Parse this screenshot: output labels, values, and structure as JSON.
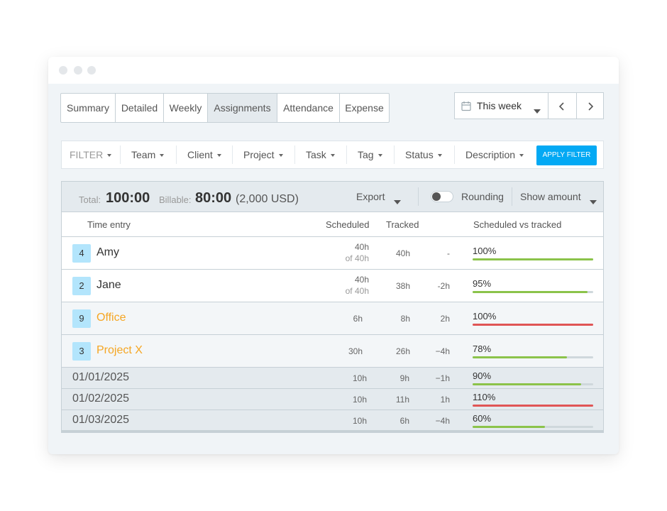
{
  "tabs": [
    {
      "label": "Summary"
    },
    {
      "label": "Detailed"
    },
    {
      "label": "Weekly"
    },
    {
      "label": "Assignments",
      "active": true
    },
    {
      "label": "Attendance"
    },
    {
      "label": "Expense"
    }
  ],
  "date_range": {
    "label": "This week"
  },
  "filter": {
    "title": "FILTER",
    "items": [
      "Team",
      "Client",
      "Project",
      "Task",
      "Tag",
      "Status",
      "Description"
    ],
    "apply_label": "APPLY FILTER"
  },
  "summary": {
    "total_label": "Total:",
    "total_value": "100:00",
    "billable_label": "Billable:",
    "billable_value": "80:00",
    "billable_amount": "(2,000 USD)",
    "export_label": "Export",
    "rounding_label": "Rounding",
    "show_amount_label": "Show amount"
  },
  "columns": {
    "time_entry": "Time entry",
    "scheduled": "Scheduled",
    "tracked": "Tracked",
    "scheduled_vs_tracked": "Scheduled vs tracked"
  },
  "entries": [
    {
      "count": "4",
      "name": "Amy",
      "scheduled": "40h",
      "scheduled_sub": "of 40h",
      "tracked": "40h",
      "diff": "-",
      "percent": "100%",
      "progress": 1.0,
      "over": false
    },
    {
      "count": "2",
      "name": "Jane",
      "scheduled": "40h",
      "scheduled_sub": "of 40h",
      "tracked": "38h",
      "diff": "-2h",
      "percent": "95%",
      "progress": 0.95,
      "over": false
    },
    {
      "count": "9",
      "name": "Office",
      "scheduled": "6h",
      "tracked": "8h",
      "diff": "2h",
      "percent": "100%",
      "progress": 1.0,
      "over": true
    },
    {
      "count": "3",
      "name": "Project X",
      "scheduled": "30h",
      "tracked": "26h",
      "diff": "−4h",
      "percent": "78%",
      "progress": 0.78,
      "over": false
    }
  ],
  "days": [
    {
      "date": "01/01/2025",
      "scheduled": "10h",
      "tracked": "9h",
      "diff": "−1h",
      "percent": "90%",
      "progress": 0.9,
      "over": false
    },
    {
      "date": "01/02/2025",
      "scheduled": "10h",
      "tracked": "11h",
      "diff": "1h",
      "percent": "110%",
      "progress": 1.0,
      "over": true
    },
    {
      "date": "01/03/2025",
      "scheduled": "10h",
      "tracked": "6h",
      "diff": "−4h",
      "percent": "60%",
      "progress": 0.6,
      "over": false
    }
  ],
  "colors": {
    "accent": "#03a9f4",
    "badge": "#b3e5fc",
    "project_name": "#f5a623",
    "bar_green": "#8bc34a",
    "bar_red": "#e05555"
  },
  "icons": [
    "calendar-icon",
    "chevron-down-icon",
    "chevron-left-icon",
    "chevron-right-icon",
    "caret-down-icon",
    "toggle-switch"
  ]
}
